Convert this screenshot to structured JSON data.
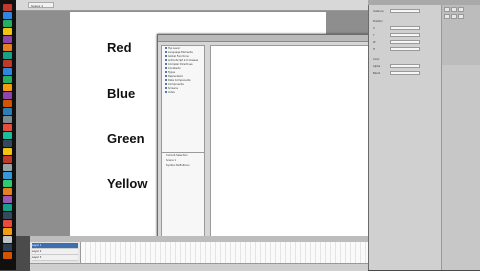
{
  "document": {
    "tab_label": "Scene 1"
  },
  "stage": {
    "words": [
      "Red",
      "Blue",
      "Green",
      "Yellow"
    ]
  },
  "actions_panel": {
    "tree_items": [
      "Top Level",
      "Language Elements",
      "Global Functions",
      "ActionScript 2.0 Classes",
      "Compiler Directives",
      "Constants",
      "Types",
      "Deprecated",
      "Data Components",
      "Components",
      "Screens",
      "Index"
    ],
    "scene_tree_items": [
      "Current Selection",
      "Scene 1",
      "Symbol Definitions"
    ],
    "bottom_tab": "Layer 1 : 1"
  },
  "timeline": {
    "layers": [
      "Layer 1",
      "Layer 2",
      "Layer 3"
    ]
  },
  "properties": {
    "labels": [
      "Instance",
      "Position",
      "X",
      "Y",
      "W",
      "H",
      "Color",
      "Alpha",
      "Blend"
    ]
  },
  "dock": {
    "icon_colors": [
      "#c0392b",
      "#2e86de",
      "#27ae60",
      "#f1c40f",
      "#8e44ad",
      "#e67e22",
      "#16a085",
      "#c0392b",
      "#2e86de",
      "#27ae60",
      "#f39c12",
      "#8e44ad",
      "#d35400",
      "#2980b9",
      "#7f8c8d",
      "#e74c3c",
      "#1abc9c",
      "#34495e",
      "#f1c40f",
      "#c0392b",
      "#95a5a6",
      "#3498db",
      "#2ecc71",
      "#e67e22",
      "#9b59b6",
      "#16a085",
      "#34495e",
      "#e74c3c",
      "#f39c12",
      "#bdc3c7",
      "#2c3e50",
      "#d35400"
    ]
  }
}
